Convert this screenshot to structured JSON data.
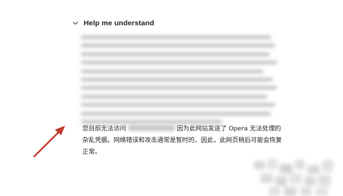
{
  "details": {
    "title": "Help me understand",
    "chevron_icon": "chevron-down-icon"
  },
  "message": {
    "prefix": "您目前无法访问",
    "suffix": "因为此网站发送了 Opera 无法处理的杂乱凭据。网络错误和攻击通常是暂时的，因此，此网页稍后可能会恢复正常。"
  },
  "annotation": {
    "arrow_color": "#c0392b",
    "arrow_icon": "red-arrow-icon"
  }
}
